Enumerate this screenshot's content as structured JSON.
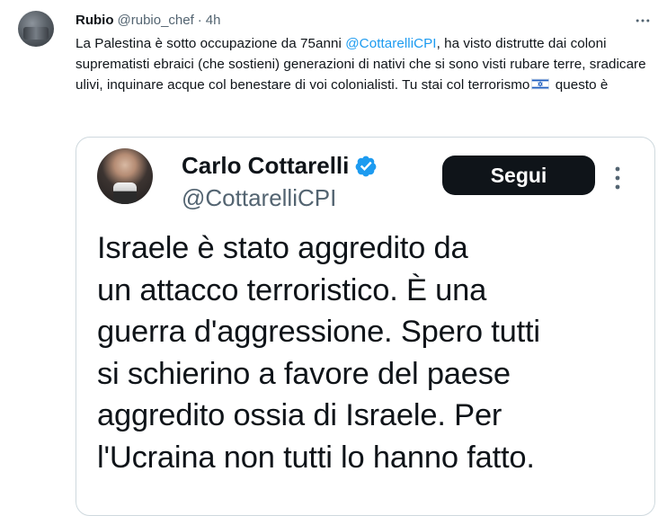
{
  "tweet": {
    "name": "Rubio",
    "handle": "@rubio_chef",
    "separator": "·",
    "time": "4h",
    "text_part1": "La Palestina è sotto occupazione da 75anni ",
    "mention": "@CottarelliCPI",
    "text_part2": ", ha visto distrutte dai coloni suprematisti ebraici (che sostieni) generazioni di nativi che si sono visti rubare terre, sradicare ulivi, inquinare acque col benestare di voi colonialisti. Tu stai col terrorismo",
    "flag_icon": "israel-flag-emoji",
    "text_part3": " questo è",
    "more_icon": "more-horizontal-icon"
  },
  "quoted": {
    "name": "Carlo Cottarelli",
    "verified_icon": "verified-badge-icon",
    "handle": "@CottarelliCPI",
    "follow_label": "Segui",
    "more_icon": "more-vertical-icon",
    "lines": [
      "Israele è stato aggredito da",
      "un attacco terroristico. È una",
      "guerra d'aggressione. Spero tutti",
      "si schierino a favore del paese",
      "aggredito ossia di Israele. Per",
      "l'Ucraina non tutti lo hanno fatto."
    ]
  },
  "colors": {
    "link": "#1d9bf0",
    "text": "#0f1419",
    "secondary": "#536471",
    "border": "#cfd9de",
    "verified": "#1d9bf0"
  }
}
